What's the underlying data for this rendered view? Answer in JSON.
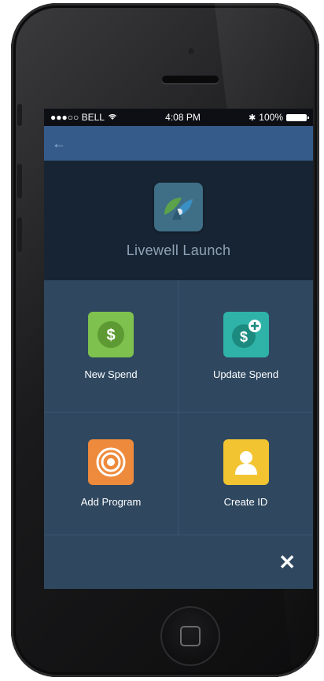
{
  "status_bar": {
    "carrier": "●●●○○ BELL",
    "time": "4:08 PM",
    "battery": "100%"
  },
  "header": {
    "app_name": "Livewell Launch"
  },
  "tiles": [
    {
      "label": "New Spend",
      "icon": "dollar-icon",
      "color": "#7ec14e"
    },
    {
      "label": "Update Spend",
      "icon": "dollar-plus-icon",
      "color": "#2fb3a8"
    },
    {
      "label": "Add Program",
      "icon": "target-icon",
      "color": "#ee8a3c"
    },
    {
      "label": "Create ID",
      "icon": "person-icon",
      "color": "#f2c431"
    }
  ],
  "colors": {
    "nav_bar": "#355b8a",
    "header_bg": "#172433",
    "grid_bg": "#2f4860"
  }
}
